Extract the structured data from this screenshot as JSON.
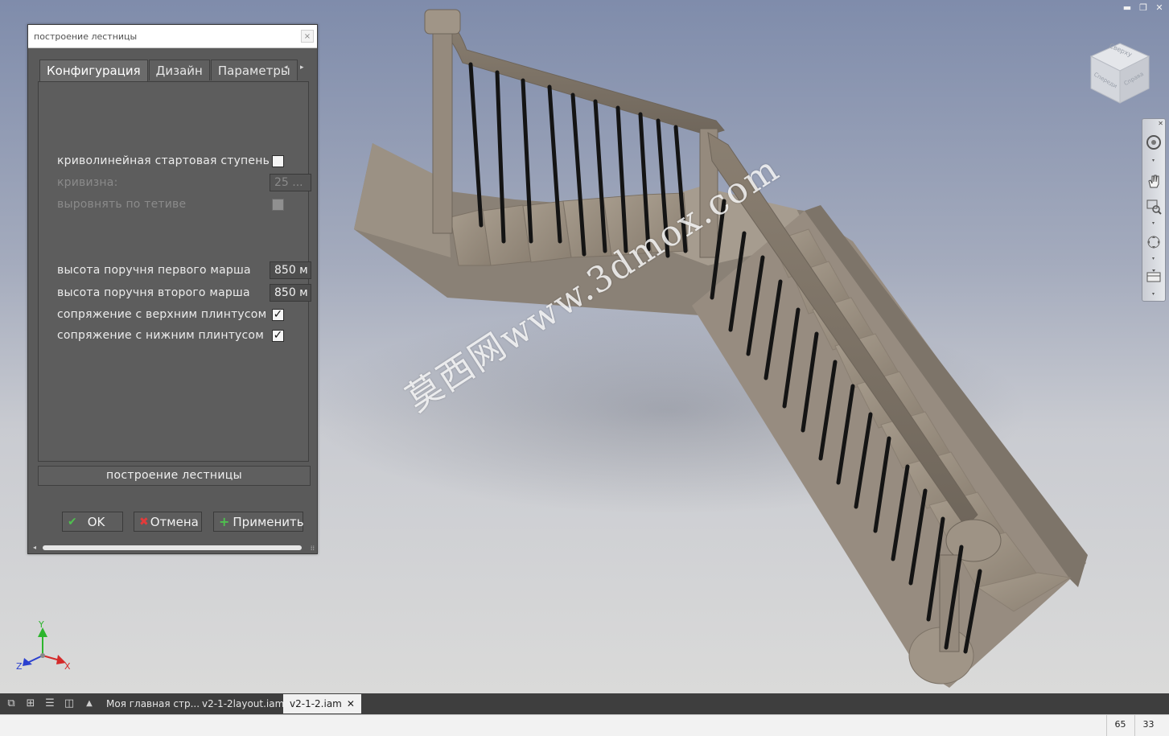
{
  "window_controls": {
    "minimize": "▬",
    "restore": "❐",
    "close": "✕"
  },
  "viewcube": {
    "top_label": "Сверху",
    "left_label": "Спереди",
    "right_label": "Справа"
  },
  "navbar": {
    "close": "✕",
    "items": [
      "steering-wheel-icon",
      "pan-hand-icon",
      "zoom-window-icon",
      "orbit-icon",
      "look-at-icon"
    ]
  },
  "axes": {
    "x": "X",
    "y": "Y",
    "z": "Z",
    "x_color": "#d42a2a",
    "y_color": "#2db52d",
    "z_color": "#2a3fcf"
  },
  "dialog": {
    "title": "построение лестницы",
    "close": "×",
    "tabs": [
      "Конфигурация",
      "Дизайн",
      "Параметры"
    ],
    "tab_scroll_left": "◂",
    "tab_scroll_right": "▸",
    "rows": {
      "curved_start": {
        "label": "криволинейная стартовая ступень",
        "checked": false
      },
      "curvature": {
        "label": "кривизна:",
        "value": "25 ..."
      },
      "align_stringer": {
        "label": "выровнять по тетиве",
        "checked": false
      },
      "rail_height_first": {
        "label": "высота поручня первого марша",
        "value": "850 м"
      },
      "rail_height_second": {
        "label": "высота поручня второго марша",
        "value": "850 м"
      },
      "join_top_skirting": {
        "label": "сопряжение с верхним плинтусом",
        "checked": true,
        "mark": "✓"
      },
      "join_bottom_skirting": {
        "label": "сопряжение с нижним плинтусом",
        "checked": true,
        "mark": "✓"
      }
    },
    "build_button": "построение лестницы",
    "ok": "OK",
    "ok_icon": "✔",
    "cancel": "Отмена",
    "cancel_icon": "✖",
    "apply": "Применить",
    "apply_icon": "+"
  },
  "watermark": "莫西网www.3dmox.com",
  "doc_tabs": {
    "tabs": [
      "Моя главная стр...",
      "v2-1-2layout.iam",
      "v2-1-2.iam"
    ],
    "active_index": 2,
    "close": "✕",
    "overflow": "▲"
  },
  "status": {
    "count1": "65",
    "count2": "33"
  }
}
